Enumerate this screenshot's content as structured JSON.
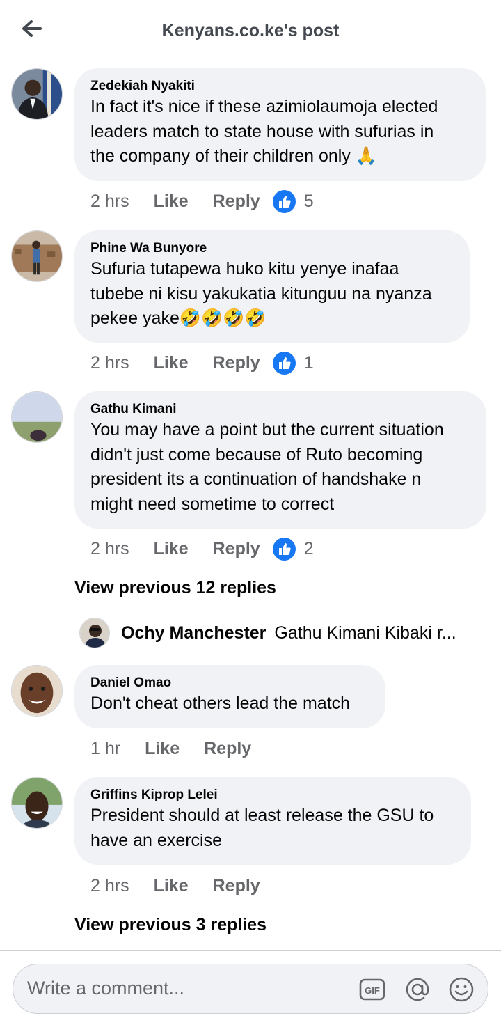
{
  "header": {
    "title": "Kenyans.co.ke's post"
  },
  "comments": [
    {
      "author": "Zedekiah Nyakiti",
      "text": "In fact it's nice if these azimiolaumoja elected\nleaders match to state house with sufurias in\nthe company of their children only 🙏",
      "time": "2 hrs",
      "like": "Like",
      "reply": "Reply",
      "reactions": "5"
    },
    {
      "author": "Phine Wa Bunyore",
      "text": "Sufuria tutapewa huko kitu yenye inafaa\ntubebe ni kisu yakukatia kitunguu na nyanza\npekee yake🤣🤣🤣🤣",
      "time": "2 hrs",
      "like": "Like",
      "reply": "Reply",
      "reactions": "1"
    },
    {
      "author": "Gathu Kimani",
      "text": "You may have a point but the current situation\ndidn't just come because of Ruto becoming\npresident its a continuation of handshake n\nmight need sometime to correct",
      "time": "2 hrs",
      "like": "Like",
      "reply": "Reply",
      "reactions": "2"
    },
    {
      "author": "Daniel Omao",
      "text": "Don't cheat others lead the match",
      "time": "1 hr",
      "like": "Like",
      "reply": "Reply"
    },
    {
      "author": "Griffins Kiprop Lelei",
      "text": "President should at least release the GSU to\nhave an exercise",
      "time": "2 hrs",
      "like": "Like",
      "reply": "Reply"
    }
  ],
  "view_previous_1": "View previous 12 replies",
  "reply_preview": {
    "author": "Ochy Manchester",
    "text": "Gathu Kimani Kibaki r..."
  },
  "view_previous_2": "View previous 3 replies",
  "composer": {
    "placeholder": "Write a comment..."
  },
  "colors": {
    "like_blue": "#1877f2",
    "bubble": "#f0f2f5",
    "secondary_text": "#65676b"
  }
}
